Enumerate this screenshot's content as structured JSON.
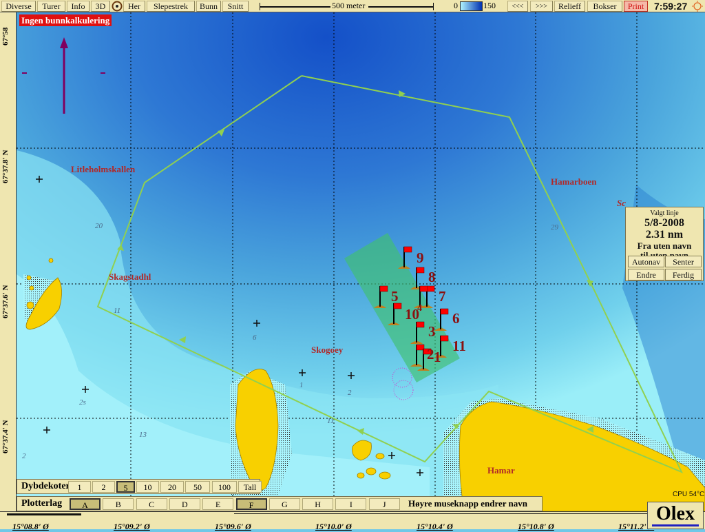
{
  "toolbar": {
    "buttons": [
      "Diverse",
      "Turer",
      "Info",
      "3D",
      "Her",
      "Slepestrek",
      "Bunn",
      "Snitt"
    ],
    "scale_label": "500 meter",
    "depth_min": "0",
    "depth_max": "150",
    "right_buttons": [
      "<<<",
      ">>>",
      "Relieff",
      "Bokser"
    ],
    "print": "Print",
    "time": "7:59:27",
    "icons": {
      "target": "target-icon",
      "sun": "sun-icon"
    }
  },
  "warning": "Ingen bunnkalkulering",
  "latitudes": [
    "67°58",
    "67°37.8' N",
    "67°37.6' N",
    "67°37.4' N"
  ],
  "longitudes": [
    "15°08.8' Ø",
    "15°09.2' Ø",
    "15°09.6' Ø",
    "15°10.0' Ø",
    "15°10.4' Ø",
    "15°10.8' Ø",
    "15°11.2' Ø"
  ],
  "places": [
    "Litleholmskallen",
    "Skagstadhl",
    "Skogoey",
    "Hamarboen",
    "Hamar",
    "Sc"
  ],
  "depths": [
    "20",
    "29",
    "11",
    "6",
    "1",
    "2",
    "13",
    "2",
    "11",
    "2s"
  ],
  "markers": [
    "9",
    "8",
    "7",
    "5",
    "10",
    "4",
    "6",
    "3",
    "11",
    "2",
    "1"
  ],
  "panel": {
    "title": "Valgt linje",
    "date": "5/8-2008",
    "distance": "2.31 nm",
    "from": "Fra uten navn",
    "to": "til uten navn",
    "buttons": [
      "Autonav",
      "Senter",
      "Endre",
      "Ferdig"
    ]
  },
  "dybdekoter": {
    "label": "Dybdekoter",
    "options": [
      "1",
      "2",
      "5",
      "10",
      "20",
      "50",
      "100",
      "Tall"
    ],
    "selected": "5"
  },
  "plotterlag": {
    "label": "Plotterlag",
    "options": [
      "A",
      "B",
      "C",
      "D",
      "E",
      "F",
      "G",
      "H",
      "I",
      "J"
    ],
    "selected": [
      "A",
      "F"
    ],
    "hint": "Høyre museknapp endrer navn"
  },
  "cpu": "CPU 54°C",
  "logo": "Olex",
  "colors": {
    "route": "#90d050",
    "land": "#f8d000",
    "marker_flag": "#ff0000",
    "deep_water": "#1a5fd0",
    "shallow_water": "#a0f0f8"
  }
}
